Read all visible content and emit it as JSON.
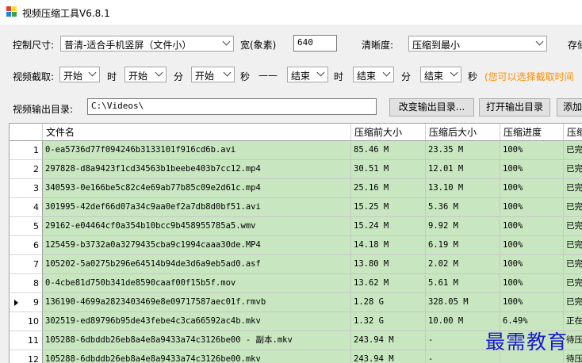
{
  "window": {
    "title": "视频压缩工具V6.8.1"
  },
  "row1": {
    "size_label": "控制尺寸:",
    "size_value": "普清-适合手机竖屏（文件小）",
    "width_label": "宽(象素)",
    "width_value": "640",
    "clarity_label": "清晰度:",
    "clarity_value": "压缩到最小",
    "save_label": "存储"
  },
  "row2": {
    "cut_label": "视频截取:",
    "start_hour": "开始",
    "hour_unit": "时",
    "start_min": "开始",
    "min_unit": "分",
    "start_sec": "开始",
    "sec_unit": "秒",
    "dash": "——",
    "end_hour": "结束",
    "end_hour_unit": "时",
    "end_min": "结束",
    "end_min_unit": "分",
    "end_sec": "结束",
    "end_sec_unit": "秒",
    "hint": "(您可以选择截取时间"
  },
  "row3": {
    "out_label": "视频输出目录:",
    "out_value": "C:\\Videos\\",
    "change_btn": "改变输出目录...",
    "open_btn": "打开输出目录",
    "add_btn": "添加"
  },
  "table": {
    "headers": [
      "文件名",
      "压缩前大小",
      "压缩后大小",
      "压缩进度",
      "压缩"
    ],
    "rows": [
      {
        "n": "1",
        "name": "0-ea5736d77f094246b3133101f916cd6b.avi",
        "before": "85.46 M",
        "after": "23.35 M",
        "progress": "100%",
        "status": "已完"
      },
      {
        "n": "2",
        "name": "297828-d8a9423f1cd34563b1beebe403b7cc12.mp4",
        "before": "30.51 M",
        "after": "12.01 M",
        "progress": "100%",
        "status": "已完"
      },
      {
        "n": "3",
        "name": "340593-0e166be5c82c4e69ab77b85c09e2d61c.mp4",
        "before": "25.16 M",
        "after": "13.10 M",
        "progress": "100%",
        "status": "已完"
      },
      {
        "n": "4",
        "name": "301995-42def66d07a34c9aa0ef2a7db8d0bf51.avi",
        "before": "15.25 M",
        "after": "5.36 M",
        "progress": "100%",
        "status": "已完"
      },
      {
        "n": "5",
        "name": "29162-e04464cf0a354b10bcc9b458955785a5.wmv",
        "before": "15.24 M",
        "after": "9.92 M",
        "progress": "100%",
        "status": "已完"
      },
      {
        "n": "6",
        "name": "125459-b3732a0a3279435cba9c1994caaa30de.MP4",
        "before": "14.18 M",
        "after": "6.19 M",
        "progress": "100%",
        "status": "已完"
      },
      {
        "n": "7",
        "name": "105202-5a0275b296e64514b94de3d6a9eb5ad0.asf",
        "before": "13.80 M",
        "after": "2.02 M",
        "progress": "100%",
        "status": "已完"
      },
      {
        "n": "8",
        "name": "0-4cbe81d750b341de8590caaf00f15b5f.mov",
        "before": "13.62 M",
        "after": "5.61 M",
        "progress": "100%",
        "status": "已完"
      },
      {
        "n": "9",
        "name": "136190-4699a2823403469e8e09717587aec01f.rmvb",
        "before": "1.28 G",
        "after": "328.05 M",
        "progress": "100%",
        "status": "已完"
      },
      {
        "n": "10",
        "name": "302519-ed89796b95de43febe4c3ca66592ac4b.mkv",
        "before": "1.32 G",
        "after": "10.00 M",
        "progress": "6.49%",
        "status": "正在"
      },
      {
        "n": "11",
        "name": "105288-6dbddb26eb8a4e8a9433a74c3126be00 - 副本.mkv",
        "before": "243.94 M",
        "after": "-",
        "progress": "",
        "status": "待压"
      },
      {
        "n": "12",
        "name": "105288-6dbddb26eb8a4e8a9433a74c3126be00.mkv",
        "before": "243.94 M",
        "after": "-",
        "progress": "",
        "status": "待压"
      }
    ]
  },
  "watermark": "最需教育"
}
